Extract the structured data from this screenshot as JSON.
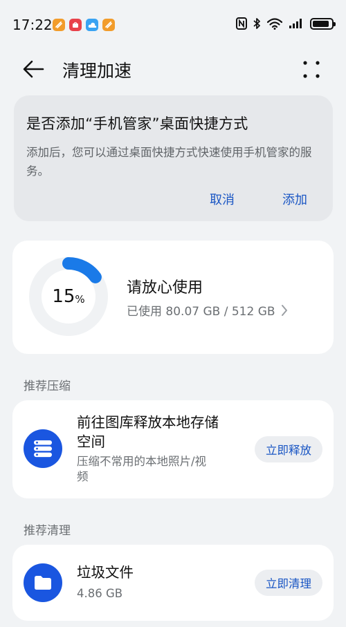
{
  "status_bar": {
    "time": "17:22",
    "notification_icons": [
      "notes-app-icon",
      "huawei-store-icon",
      "cloud-icon",
      "notes-app-icon"
    ],
    "system_icons": [
      "nfc-icon",
      "bluetooth-icon",
      "wifi-icon",
      "signal-icon",
      "battery-icon"
    ],
    "battery_level": 0.9
  },
  "header": {
    "title": "清理加速"
  },
  "shortcut_prompt": {
    "title": "是否添加“手机管家”桌面快捷方式",
    "body": "添加后，您可以通过桌面快捷方式快速使用手机管家的服务。",
    "cancel_label": "取消",
    "add_label": "添加"
  },
  "storage": {
    "percent": "15",
    "percent_symbol": "%",
    "ring_fraction": 0.15,
    "status": "请放心使用",
    "usage": "已使用 80.07 GB / 512 GB"
  },
  "compress_section": {
    "label": "推荐压缩",
    "card": {
      "title_line1": "前往图库释放本地存储",
      "title_line2": "空间",
      "desc_line1": "压缩不常用的本地照片/视",
      "desc_line2": "频",
      "button_label": "立即释放"
    }
  },
  "clean_section": {
    "label": "推荐清理",
    "card": {
      "title": "垃圾文件",
      "size": "4.86 GB",
      "button_label": "立即清理"
    }
  },
  "colors": {
    "accent": "#1a56c4",
    "icon_blue": "#1a56e0",
    "ring_fill": "#1a7ae8",
    "ring_track": "#f0f2f4",
    "background": "#f1f3f5"
  }
}
